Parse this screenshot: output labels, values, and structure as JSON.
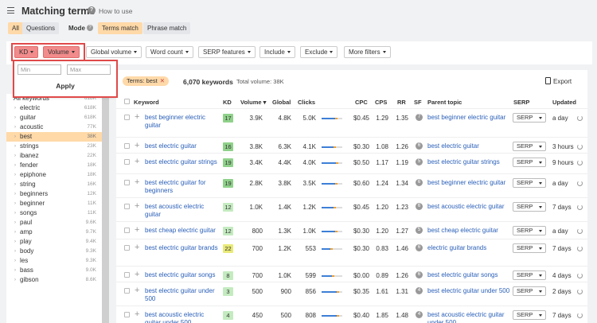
{
  "header": {
    "title": "Matching terms",
    "help_link": "How to use"
  },
  "modebar": {
    "all": "All",
    "questions": "Questions",
    "mode_label": "Mode",
    "terms_match": "Terms match",
    "phrase_match": "Phrase match"
  },
  "filters": [
    {
      "label": "KD",
      "highlighted": true
    },
    {
      "label": "Volume",
      "highlighted": true
    },
    {
      "label": "Global volume",
      "highlighted": false
    },
    {
      "label": "Word count",
      "highlighted": false
    },
    {
      "label": "SERP features",
      "highlighted": false
    },
    {
      "label": "Include",
      "highlighted": false
    },
    {
      "label": "Exclude",
      "highlighted": false
    },
    {
      "label": "More filters",
      "highlighted": false
    }
  ],
  "popup": {
    "min_placeholder": "Min",
    "max_placeholder": "Max",
    "apply": "Apply"
  },
  "sidebar": {
    "items": [
      {
        "label": "All keywords",
        "count": "618K"
      },
      {
        "label": "electric",
        "count": "618K"
      },
      {
        "label": "guitar",
        "count": "618K"
      },
      {
        "label": "acoustic",
        "count": "77K"
      },
      {
        "label": "best",
        "count": "38K"
      },
      {
        "label": "strings",
        "count": "23K"
      },
      {
        "label": "ibanez",
        "count": "22K"
      },
      {
        "label": "fender",
        "count": "18K"
      },
      {
        "label": "epiphone",
        "count": "18K"
      },
      {
        "label": "string",
        "count": "16K"
      },
      {
        "label": "beginners",
        "count": "12K"
      },
      {
        "label": "beginner",
        "count": "11K"
      },
      {
        "label": "songs",
        "count": "11K"
      },
      {
        "label": "paul",
        "count": "9.6K"
      },
      {
        "label": "amp",
        "count": "9.7K"
      },
      {
        "label": "play",
        "count": "9.4K"
      },
      {
        "label": "body",
        "count": "9.3K"
      },
      {
        "label": "les",
        "count": "9.3K"
      },
      {
        "label": "bass",
        "count": "9.0K"
      },
      {
        "label": "gibson",
        "count": "8.6K"
      }
    ]
  },
  "summary": {
    "term_tag": "Terms: best",
    "keyword_count": "6,070 keywords",
    "total_volume": "Total volume: 38K",
    "export": "Export"
  },
  "columns": [
    "Keyword",
    "KD",
    "Volume ▾",
    "Global",
    "Clicks",
    "CPC",
    "CPS",
    "RR",
    "SF",
    "Parent topic",
    "SERP",
    "Updated"
  ],
  "colors": {
    "kd_green_dark": "#8fd18a",
    "kd_green_light": "#c4ebc0",
    "kd_yellow": "#e9ea78",
    "clicks_blue": "#3d7fd6",
    "clicks_orange": "#f0a030",
    "link_blue": "#2a5fb8",
    "highlight_orange": "#ffd9a8"
  },
  "rows": [
    {
      "keyword": "best beginner electric guitar",
      "kd": "17",
      "volume": "3.9K",
      "global": "4.8K",
      "clicks": "5.0K",
      "cpc": "$0.45",
      "cps": "1.29",
      "rr": "1.35",
      "sf": "7",
      "parent": "best beginner electric guitar",
      "serp": "SERP",
      "updated": "a day",
      "clicks_ratio": 0.75
    },
    {
      "keyword": "best electric guitar",
      "kd": "16",
      "volume": "3.8K",
      "global": "6.3K",
      "clicks": "4.1K",
      "cpc": "$0.30",
      "cps": "1.08",
      "rr": "1.26",
      "sf": "6",
      "parent": "best electric guitar",
      "serp": "SERP",
      "updated": "3 hours",
      "clicks_ratio": 0.7
    },
    {
      "keyword": "best electric guitar strings",
      "kd": "19",
      "volume": "3.4K",
      "global": "4.4K",
      "clicks": "4.0K",
      "cpc": "$0.50",
      "cps": "1.17",
      "rr": "1.19",
      "sf": "5",
      "parent": "best electric guitar strings",
      "serp": "SERP",
      "updated": "9 hours",
      "clicks_ratio": 0.8
    },
    {
      "keyword": "best electric guitar for beginners",
      "kd": "19",
      "volume": "2.8K",
      "global": "3.8K",
      "clicks": "3.5K",
      "cpc": "$0.60",
      "cps": "1.24",
      "rr": "1.34",
      "sf": "6",
      "parent": "best beginner electric guitar",
      "serp": "SERP",
      "updated": "a day",
      "clicks_ratio": 0.75
    },
    {
      "keyword": "best acoustic electric guitar",
      "kd": "12",
      "volume": "1.0K",
      "global": "1.4K",
      "clicks": "1.2K",
      "cpc": "$0.45",
      "cps": "1.20",
      "rr": "1.23",
      "sf": "6",
      "parent": "best acoustic electric guitar",
      "serp": "SERP",
      "updated": "7 days",
      "clicks_ratio": 0.7
    },
    {
      "keyword": "best cheap electric guitar",
      "kd": "12",
      "volume": "800",
      "global": "1.3K",
      "clicks": "1.0K",
      "cpc": "$0.30",
      "cps": "1.20",
      "rr": "1.27",
      "sf": "5",
      "parent": "best cheap electric guitar",
      "serp": "SERP",
      "updated": "a day",
      "clicks_ratio": 0.75
    },
    {
      "keyword": "best electric guitar brands",
      "kd": "22",
      "volume": "700",
      "global": "1.2K",
      "clicks": "553",
      "cpc": "$0.30",
      "cps": "0.83",
      "rr": "1.46",
      "sf": "6",
      "parent": "electric guitar brands",
      "serp": "SERP",
      "updated": "7 days",
      "clicks_ratio": 0.55
    },
    {
      "keyword": "best electric guitar songs",
      "kd": "8",
      "volume": "700",
      "global": "1.0K",
      "clicks": "599",
      "cpc": "$0.00",
      "cps": "0.89",
      "rr": "1.26",
      "sf": "6",
      "parent": "best electric guitar songs",
      "serp": "SERP",
      "updated": "4 days",
      "clicks_ratio": 0.6
    },
    {
      "keyword": "best electric guitar under 500",
      "kd": "3",
      "volume": "500",
      "global": "900",
      "clicks": "856",
      "cpc": "$0.35",
      "cps": "1.61",
      "rr": "1.31",
      "sf": "4",
      "parent": "best electric guitar under 500",
      "serp": "SERP",
      "updated": "2 days",
      "clicks_ratio": 0.85
    },
    {
      "keyword": "best acoustic electric guitar under 500",
      "kd": "4",
      "volume": "450",
      "global": "500",
      "clicks": "808",
      "cpc": "$0.40",
      "cps": "1.85",
      "rr": "1.48",
      "sf": "4",
      "parent": "best acoustic electric guitar under 500",
      "serp": "SERP",
      "updated": "7 days",
      "clicks_ratio": 0.85
    }
  ]
}
